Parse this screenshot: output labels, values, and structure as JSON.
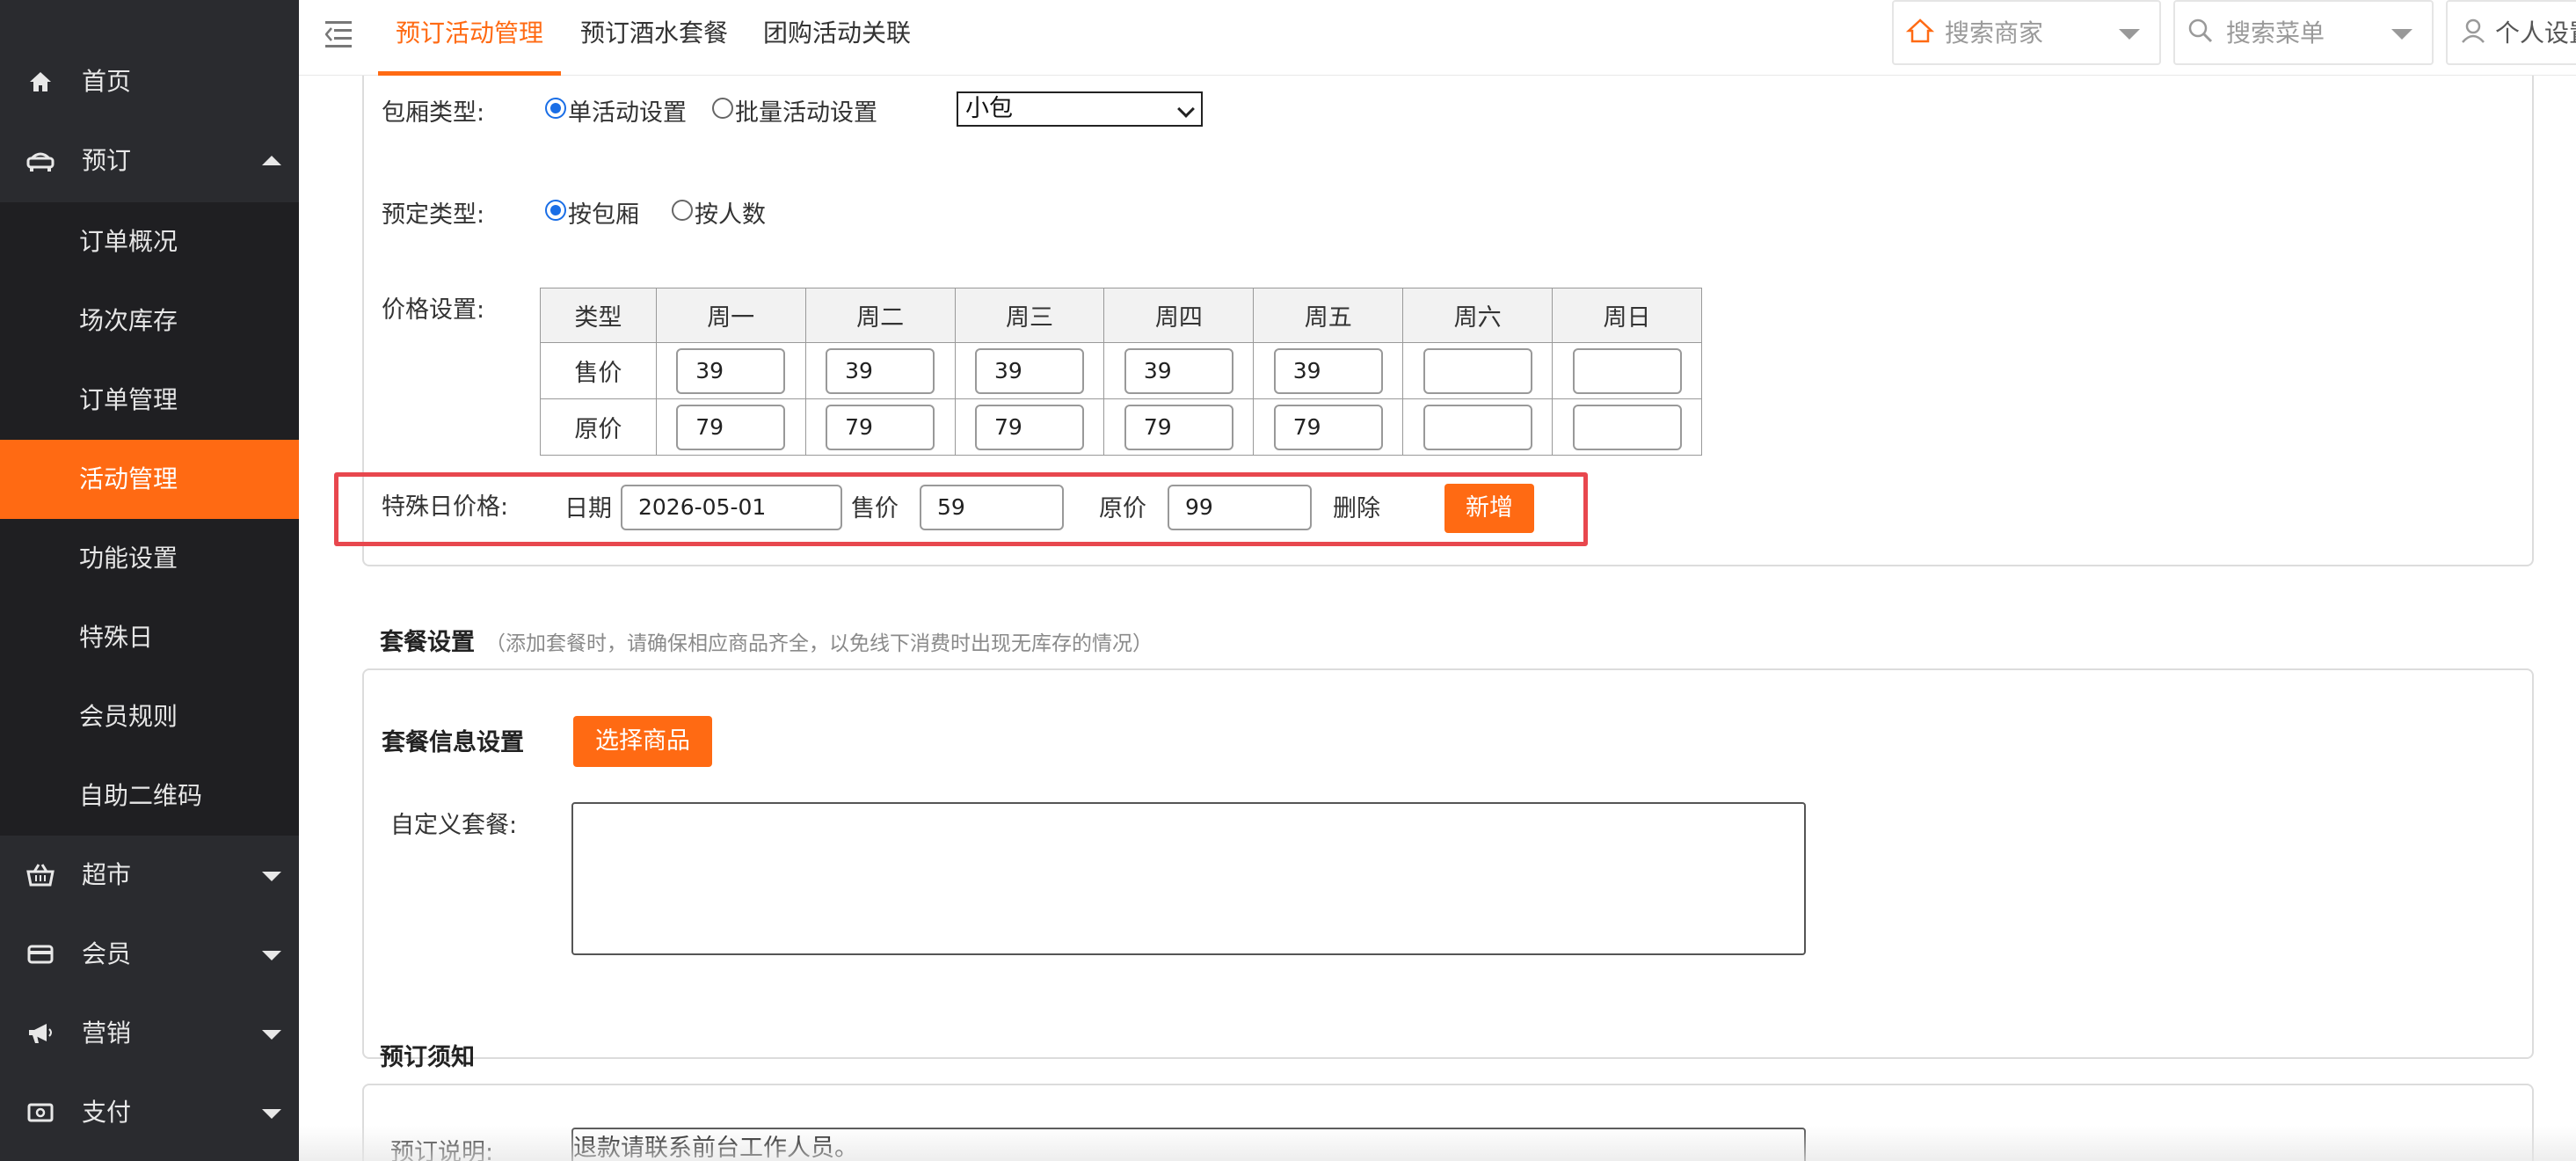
{
  "sidebar": {
    "brand": "",
    "items": [
      {
        "label": "首页",
        "icon": "home-icon"
      },
      {
        "label": "预订",
        "icon": "booking-icon"
      },
      {
        "label": "超市",
        "icon": "basket-icon"
      },
      {
        "label": "会员",
        "icon": "card-icon"
      },
      {
        "label": "营销",
        "icon": "megaphone-icon"
      },
      {
        "label": "支付",
        "icon": "payment-icon"
      }
    ],
    "sub_items": [
      "订单概况",
      "场次库存",
      "订单管理",
      "活动管理",
      "功能设置",
      "特殊日",
      "会员规则",
      "自助二维码"
    ]
  },
  "topbar": {
    "tabs": [
      "预订活动管理",
      "预订酒水套餐",
      "团购活动关联"
    ],
    "search_merchant": "搜索商家",
    "search_menu": "搜索菜单",
    "personal": "个人设置"
  },
  "form": {
    "room_type_label": "包厢类型:",
    "radio_single": "单活动设置",
    "radio_batch": "批量活动设置",
    "room_select": "小包",
    "booking_type_label": "预定类型:",
    "radio_by_room": "按包厢",
    "radio_by_person": "按人数",
    "price_label": "价格设置:"
  },
  "price_table": {
    "headers": [
      "类型",
      "周一",
      "周二",
      "周三",
      "周四",
      "周五",
      "周六",
      "周日"
    ],
    "rows": [
      {
        "name": "售价",
        "values": [
          "39",
          "39",
          "39",
          "39",
          "39",
          "",
          ""
        ]
      },
      {
        "name": "原价",
        "values": [
          "79",
          "79",
          "79",
          "79",
          "79",
          "",
          ""
        ]
      }
    ]
  },
  "special": {
    "label": "特殊日价格:",
    "date_label": "日期",
    "date_value": "2026-05-01",
    "sale_label": "售价",
    "sale_value": "59",
    "orig_label": "原价",
    "orig_value": "99",
    "delete": "删除",
    "add": "新增"
  },
  "package": {
    "title": "套餐设置",
    "note": "（添加套餐时，请确保相应商品齐全，以免线下消费时出现无库存的情况）",
    "info_title": "套餐信息设置",
    "select_btn": "选择商品",
    "custom_label": "自定义套餐:",
    "custom_value": ""
  },
  "notice": {
    "title": "预订须知",
    "desc_label": "预订说明:",
    "desc_value": "退款请联系前台工作人员。"
  },
  "colors": {
    "accent": "#ff6a13",
    "sidebar": "#2a2b2f",
    "highlight": "#e8474e"
  }
}
